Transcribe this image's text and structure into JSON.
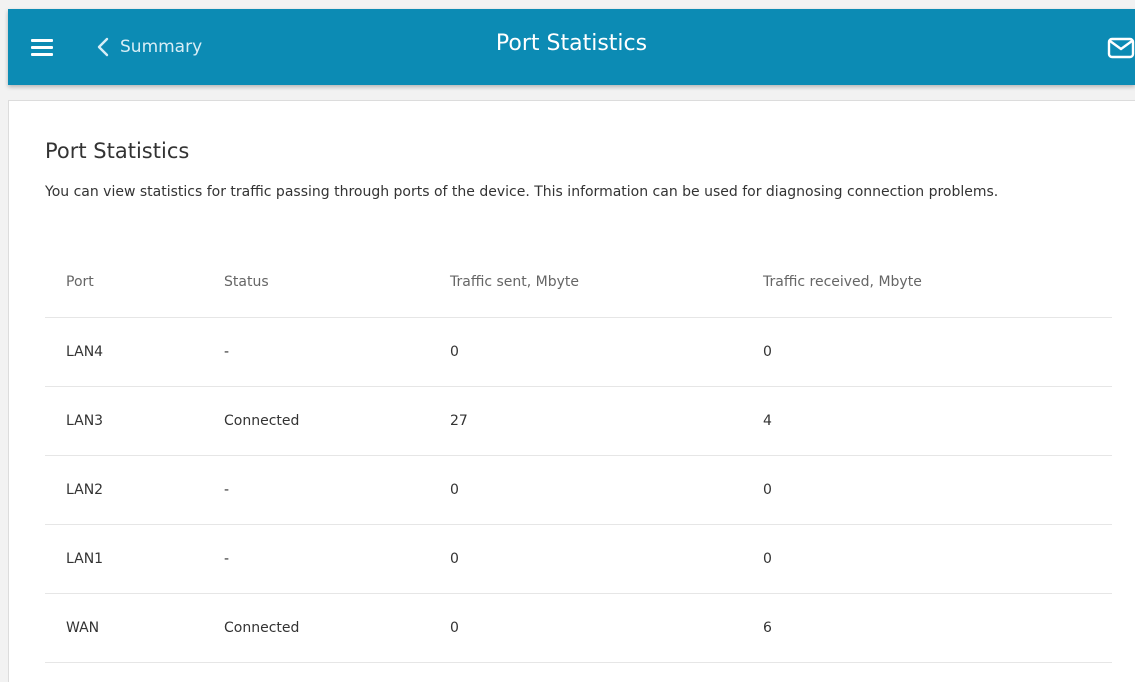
{
  "header": {
    "back_label": "Summary",
    "title": "Port Statistics",
    "menu_icon": "hamburger-menu-icon",
    "back_icon": "chevron-left-icon",
    "mail_icon": "mail-icon"
  },
  "page": {
    "heading": "Port Statistics",
    "description": "You can view statistics for traffic passing through ports of the device. This information can be used for diagnosing connection problems."
  },
  "table": {
    "columns": [
      "Port",
      "Status",
      "Traffic sent, Mbyte",
      "Traffic received, Mbyte"
    ],
    "rows": [
      {
        "port": "LAN4",
        "status": "-",
        "sent": "0",
        "received": "0"
      },
      {
        "port": "LAN3",
        "status": "Connected",
        "sent": "27",
        "received": "4"
      },
      {
        "port": "LAN2",
        "status": "-",
        "sent": "0",
        "received": "0"
      },
      {
        "port": "LAN1",
        "status": "-",
        "sent": "0",
        "received": "0"
      },
      {
        "port": "WAN",
        "status": "Connected",
        "sent": "0",
        "received": "6"
      }
    ]
  },
  "colors": {
    "header_bg": "#0c8bb4",
    "connected": "#2f9a2f",
    "disconnected": "#e2562a"
  }
}
